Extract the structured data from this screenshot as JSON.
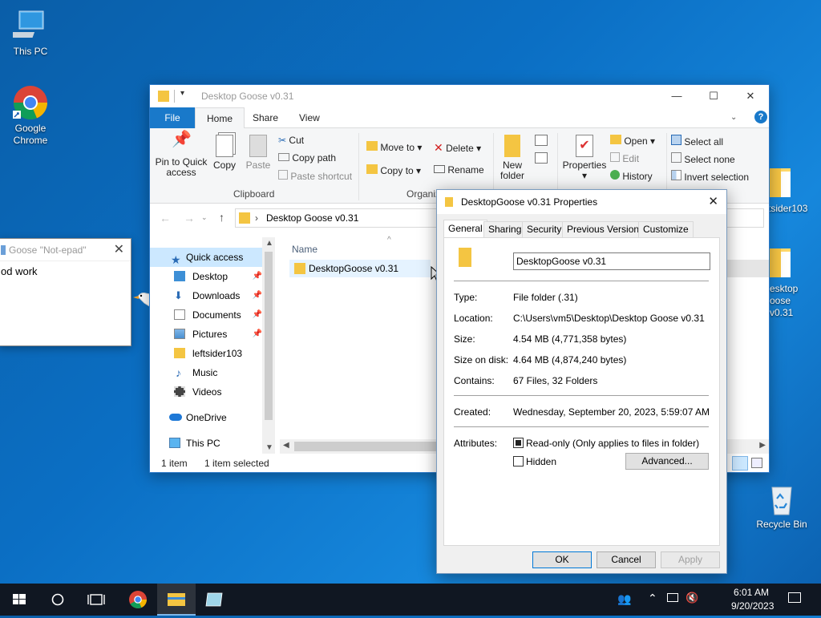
{
  "desktop": {
    "icons": [
      {
        "label": "This PC"
      },
      {
        "label": "Google Chrome"
      },
      {
        "label": "Recycle Bin"
      },
      {
        "label": "tsider103"
      },
      {
        "label": "esktop oose v0.31"
      }
    ]
  },
  "explorer": {
    "title": "Desktop Goose v0.31",
    "tabs": {
      "file": "File",
      "home": "Home",
      "share": "Share",
      "view": "View"
    },
    "ribbon": {
      "pin": "Pin to Quick access",
      "copy": "Copy",
      "paste": "Paste",
      "cut": "Cut",
      "copy_path": "Copy path",
      "paste_shortcut": "Paste shortcut",
      "clipboard": "Clipboard",
      "move_to": "Move to",
      "copy_to": "Copy to",
      "delete": "Delete",
      "rename": "Rename",
      "organize": "Organiz",
      "new_folder": "New folder",
      "properties": "Properties",
      "open": "Open",
      "edit": "Edit",
      "history": "History",
      "select_all": "Select all",
      "select_none": "Select none",
      "invert_selection": "Invert selection"
    },
    "address": "Desktop Goose v0.31",
    "nav": [
      {
        "label": "Quick access",
        "pinned": false
      },
      {
        "label": "Desktop",
        "pinned": true
      },
      {
        "label": "Downloads",
        "pinned": true
      },
      {
        "label": "Documents",
        "pinned": true
      },
      {
        "label": "Pictures",
        "pinned": true
      },
      {
        "label": "leftsider103",
        "pinned": false
      },
      {
        "label": "Music",
        "pinned": false
      },
      {
        "label": "Videos",
        "pinned": false
      },
      {
        "label": "OneDrive",
        "pinned": false
      },
      {
        "label": "This PC",
        "pinned": false
      }
    ],
    "column_name": "Name",
    "file_item": "DesktopGoose v0.31",
    "status_count": "1 item",
    "status_selected": "1 item selected"
  },
  "notepad": {
    "title": "Goose \"Not-epad\"",
    "text": "od work"
  },
  "properties": {
    "title": "DesktopGoose v0.31 Properties",
    "tabs": [
      "General",
      "Sharing",
      "Security",
      "Previous Versions",
      "Customize"
    ],
    "name_value": "DesktopGoose v0.31",
    "type_label": "Type:",
    "type_value": "File folder (.31)",
    "location_label": "Location:",
    "location_value": "C:\\Users\\vm5\\Desktop\\Desktop Goose v0.31",
    "size_label": "Size:",
    "size_value": "4.54 MB (4,771,358 bytes)",
    "size_disk_label": "Size on disk:",
    "size_disk_value": "4.64 MB (4,874,240 bytes)",
    "contains_label": "Contains:",
    "contains_value": "67 Files, 32 Folders",
    "created_label": "Created:",
    "created_value": "Wednesday, September 20, 2023, 5:59:07 AM",
    "attributes_label": "Attributes:",
    "readonly_label": "Read-only (Only applies to files in folder)",
    "readonly_checked": true,
    "hidden_label": "Hidden",
    "hidden_checked": false,
    "advanced": "Advanced...",
    "ok": "OK",
    "cancel": "Cancel",
    "apply": "Apply"
  },
  "taskbar": {
    "time": "6:01 AM",
    "date": "9/20/2023"
  },
  "colors": {
    "accent": "#1979ca",
    "taskbar": "#101722",
    "folder": "#f4c542"
  }
}
